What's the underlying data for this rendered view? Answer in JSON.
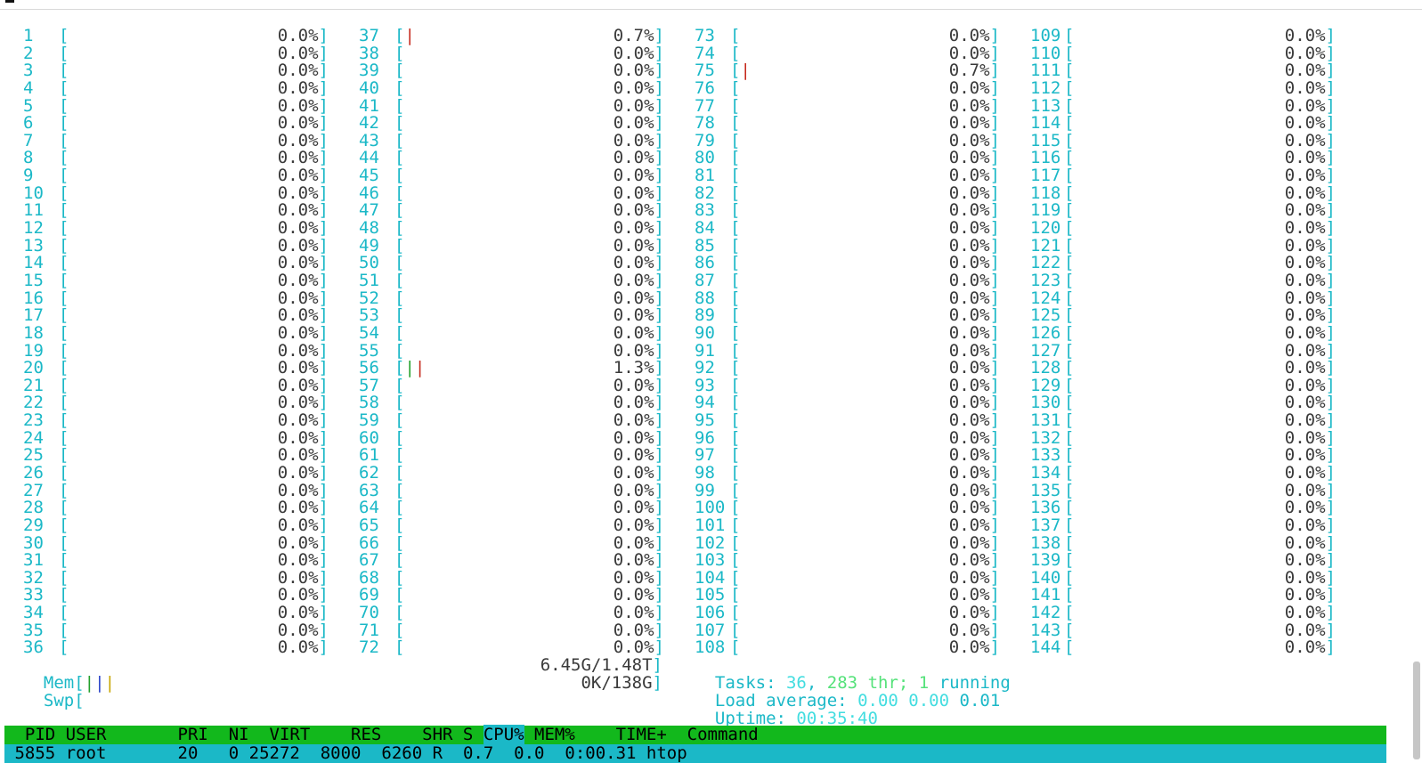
{
  "cpu_columns": [
    {
      "cores": [
        {
          "id": "1",
          "pct": "0.0%"
        },
        {
          "id": "2",
          "pct": "0.0%"
        },
        {
          "id": "3",
          "pct": "0.0%"
        },
        {
          "id": "4",
          "pct": "0.0%"
        },
        {
          "id": "5",
          "pct": "0.0%"
        },
        {
          "id": "6",
          "pct": "0.0%"
        },
        {
          "id": "7",
          "pct": "0.0%"
        },
        {
          "id": "8",
          "pct": "0.0%"
        },
        {
          "id": "9",
          "pct": "0.0%"
        },
        {
          "id": "10",
          "pct": "0.0%"
        },
        {
          "id": "11",
          "pct": "0.0%"
        },
        {
          "id": "12",
          "pct": "0.0%"
        },
        {
          "id": "13",
          "pct": "0.0%"
        },
        {
          "id": "14",
          "pct": "0.0%"
        },
        {
          "id": "15",
          "pct": "0.0%"
        },
        {
          "id": "16",
          "pct": "0.0%"
        },
        {
          "id": "17",
          "pct": "0.0%"
        },
        {
          "id": "18",
          "pct": "0.0%"
        },
        {
          "id": "19",
          "pct": "0.0%"
        },
        {
          "id": "20",
          "pct": "0.0%"
        },
        {
          "id": "21",
          "pct": "0.0%"
        },
        {
          "id": "22",
          "pct": "0.0%"
        },
        {
          "id": "23",
          "pct": "0.0%"
        },
        {
          "id": "24",
          "pct": "0.0%"
        },
        {
          "id": "25",
          "pct": "0.0%"
        },
        {
          "id": "26",
          "pct": "0.0%"
        },
        {
          "id": "27",
          "pct": "0.0%"
        },
        {
          "id": "28",
          "pct": "0.0%"
        },
        {
          "id": "29",
          "pct": "0.0%"
        },
        {
          "id": "30",
          "pct": "0.0%"
        },
        {
          "id": "31",
          "pct": "0.0%"
        },
        {
          "id": "32",
          "pct": "0.0%"
        },
        {
          "id": "33",
          "pct": "0.0%"
        },
        {
          "id": "34",
          "pct": "0.0%"
        },
        {
          "id": "35",
          "pct": "0.0%"
        },
        {
          "id": "36",
          "pct": "0.0%"
        }
      ]
    },
    {
      "cores": [
        {
          "id": "37",
          "pct": "0.7%",
          "bar": "|",
          "bar_color": "red"
        },
        {
          "id": "38",
          "pct": "0.0%"
        },
        {
          "id": "39",
          "pct": "0.0%"
        },
        {
          "id": "40",
          "pct": "0.0%"
        },
        {
          "id": "41",
          "pct": "0.0%"
        },
        {
          "id": "42",
          "pct": "0.0%"
        },
        {
          "id": "43",
          "pct": "0.0%"
        },
        {
          "id": "44",
          "pct": "0.0%"
        },
        {
          "id": "45",
          "pct": "0.0%"
        },
        {
          "id": "46",
          "pct": "0.0%"
        },
        {
          "id": "47",
          "pct": "0.0%"
        },
        {
          "id": "48",
          "pct": "0.0%"
        },
        {
          "id": "49",
          "pct": "0.0%"
        },
        {
          "id": "50",
          "pct": "0.0%"
        },
        {
          "id": "51",
          "pct": "0.0%"
        },
        {
          "id": "52",
          "pct": "0.0%"
        },
        {
          "id": "53",
          "pct": "0.0%"
        },
        {
          "id": "54",
          "pct": "0.0%"
        },
        {
          "id": "55",
          "pct": "0.0%"
        },
        {
          "id": "56",
          "pct": "1.3%",
          "bar": "||",
          "bar_color": "green-red"
        },
        {
          "id": "57",
          "pct": "0.0%"
        },
        {
          "id": "58",
          "pct": "0.0%"
        },
        {
          "id": "59",
          "pct": "0.0%"
        },
        {
          "id": "60",
          "pct": "0.0%"
        },
        {
          "id": "61",
          "pct": "0.0%"
        },
        {
          "id": "62",
          "pct": "0.0%"
        },
        {
          "id": "63",
          "pct": "0.0%"
        },
        {
          "id": "64",
          "pct": "0.0%"
        },
        {
          "id": "65",
          "pct": "0.0%"
        },
        {
          "id": "66",
          "pct": "0.0%"
        },
        {
          "id": "67",
          "pct": "0.0%"
        },
        {
          "id": "68",
          "pct": "0.0%"
        },
        {
          "id": "69",
          "pct": "0.0%"
        },
        {
          "id": "70",
          "pct": "0.0%"
        },
        {
          "id": "71",
          "pct": "0.0%"
        },
        {
          "id": "72",
          "pct": "0.0%"
        }
      ]
    },
    {
      "cores": [
        {
          "id": "73",
          "pct": "0.0%"
        },
        {
          "id": "74",
          "pct": "0.0%"
        },
        {
          "id": "75",
          "pct": "0.7%",
          "bar": "|",
          "bar_color": "red"
        },
        {
          "id": "76",
          "pct": "0.0%"
        },
        {
          "id": "77",
          "pct": "0.0%"
        },
        {
          "id": "78",
          "pct": "0.0%"
        },
        {
          "id": "79",
          "pct": "0.0%"
        },
        {
          "id": "80",
          "pct": "0.0%"
        },
        {
          "id": "81",
          "pct": "0.0%"
        },
        {
          "id": "82",
          "pct": "0.0%"
        },
        {
          "id": "83",
          "pct": "0.0%"
        },
        {
          "id": "84",
          "pct": "0.0%"
        },
        {
          "id": "85",
          "pct": "0.0%"
        },
        {
          "id": "86",
          "pct": "0.0%"
        },
        {
          "id": "87",
          "pct": "0.0%"
        },
        {
          "id": "88",
          "pct": "0.0%"
        },
        {
          "id": "89",
          "pct": "0.0%"
        },
        {
          "id": "90",
          "pct": "0.0%"
        },
        {
          "id": "91",
          "pct": "0.0%"
        },
        {
          "id": "92",
          "pct": "0.0%"
        },
        {
          "id": "93",
          "pct": "0.0%"
        },
        {
          "id": "94",
          "pct": "0.0%"
        },
        {
          "id": "95",
          "pct": "0.0%"
        },
        {
          "id": "96",
          "pct": "0.0%"
        },
        {
          "id": "97",
          "pct": "0.0%"
        },
        {
          "id": "98",
          "pct": "0.0%"
        },
        {
          "id": "99",
          "pct": "0.0%"
        },
        {
          "id": "100",
          "pct": "0.0%"
        },
        {
          "id": "101",
          "pct": "0.0%"
        },
        {
          "id": "102",
          "pct": "0.0%"
        },
        {
          "id": "103",
          "pct": "0.0%"
        },
        {
          "id": "104",
          "pct": "0.0%"
        },
        {
          "id": "105",
          "pct": "0.0%"
        },
        {
          "id": "106",
          "pct": "0.0%"
        },
        {
          "id": "107",
          "pct": "0.0%"
        },
        {
          "id": "108",
          "pct": "0.0%"
        }
      ]
    },
    {
      "cores": [
        {
          "id": "109",
          "pct": "0.0%"
        },
        {
          "id": "110",
          "pct": "0.0%"
        },
        {
          "id": "111",
          "pct": "0.0%"
        },
        {
          "id": "112",
          "pct": "0.0%"
        },
        {
          "id": "113",
          "pct": "0.0%"
        },
        {
          "id": "114",
          "pct": "0.0%"
        },
        {
          "id": "115",
          "pct": "0.0%"
        },
        {
          "id": "116",
          "pct": "0.0%"
        },
        {
          "id": "117",
          "pct": "0.0%"
        },
        {
          "id": "118",
          "pct": "0.0%"
        },
        {
          "id": "119",
          "pct": "0.0%"
        },
        {
          "id": "120",
          "pct": "0.0%"
        },
        {
          "id": "121",
          "pct": "0.0%"
        },
        {
          "id": "122",
          "pct": "0.0%"
        },
        {
          "id": "123",
          "pct": "0.0%"
        },
        {
          "id": "124",
          "pct": "0.0%"
        },
        {
          "id": "125",
          "pct": "0.0%"
        },
        {
          "id": "126",
          "pct": "0.0%"
        },
        {
          "id": "127",
          "pct": "0.0%"
        },
        {
          "id": "128",
          "pct": "0.0%"
        },
        {
          "id": "129",
          "pct": "0.0%"
        },
        {
          "id": "130",
          "pct": "0.0%"
        },
        {
          "id": "131",
          "pct": "0.0%"
        },
        {
          "id": "132",
          "pct": "0.0%"
        },
        {
          "id": "133",
          "pct": "0.0%"
        },
        {
          "id": "134",
          "pct": "0.0%"
        },
        {
          "id": "135",
          "pct": "0.0%"
        },
        {
          "id": "136",
          "pct": "0.0%"
        },
        {
          "id": "137",
          "pct": "0.0%"
        },
        {
          "id": "138",
          "pct": "0.0%"
        },
        {
          "id": "139",
          "pct": "0.0%"
        },
        {
          "id": "140",
          "pct": "0.0%"
        },
        {
          "id": "141",
          "pct": "0.0%"
        },
        {
          "id": "142",
          "pct": "0.0%"
        },
        {
          "id": "143",
          "pct": "0.0%"
        },
        {
          "id": "144",
          "pct": "0.0%"
        }
      ]
    }
  ],
  "mem": {
    "label": "Mem",
    "bar": "|||",
    "value": "6.45G/1.48T"
  },
  "swp": {
    "label": "Swp",
    "bar": "",
    "value": "0K/138G"
  },
  "tasks": {
    "label": "Tasks:",
    "count": "36",
    "sep": ",",
    "threads": "283",
    "thr_label": "thr;",
    "running": "1",
    "running_label": "running"
  },
  "load": {
    "label": "Load average:",
    "one": "0.00",
    "five": "0.00",
    "fifteen": "0.01"
  },
  "uptime": {
    "label": "Uptime:",
    "value": "00:35:40"
  },
  "table_header": {
    "pid": "PID",
    "user": "USER",
    "pri": "PRI",
    "ni": "NI",
    "virt": "VIRT",
    "res": "RES",
    "shr": "SHR",
    "s": "S",
    "cpu": "CPU%",
    "mem": "MEM%",
    "time": "TIME+",
    "command": "Command"
  },
  "process_row": {
    "pid": "5855",
    "user": "root",
    "pri": "20",
    "ni": "0",
    "virt": "25272",
    "res": "8000",
    "shr": "6260",
    "s": "R",
    "cpu": "0.7",
    "mem": "0.0",
    "time": "0:00.31",
    "command": "htop"
  },
  "colors": {
    "cyan": "#1bb8c7",
    "header_green": "#12b81c",
    "bar_red": "#c62a1e",
    "bar_green": "#22a02a"
  }
}
